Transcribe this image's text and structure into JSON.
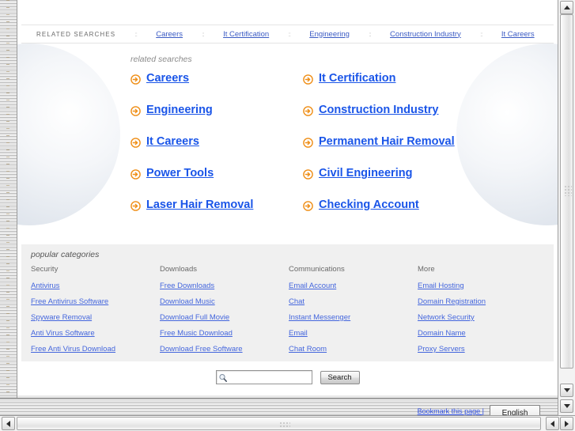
{
  "related_nav": {
    "label": "RELATED SEARCHES",
    "separator": "::",
    "links": [
      "Careers",
      "It Certification",
      "Engineering",
      "Construction Industry",
      "It Careers"
    ]
  },
  "main": {
    "caption": "related searches",
    "links": [
      [
        "Careers",
        "It Certification"
      ],
      [
        "Engineering",
        "Construction Industry"
      ],
      [
        "It Careers",
        "Permanent Hair Removal"
      ],
      [
        "Power Tools",
        "Civil Engineering"
      ],
      [
        "Laser Hair Removal",
        "Checking Account"
      ]
    ]
  },
  "categories": {
    "caption": "popular categories",
    "columns": [
      {
        "heading": "Security",
        "links": [
          "Antivirus",
          "Free Antivirus Software",
          "Spyware Removal",
          "Anti Virus Software",
          "Free Anti Virus Download"
        ]
      },
      {
        "heading": "Downloads",
        "links": [
          "Free Downloads",
          "Download Music",
          "Download Full Movie",
          "Free Music Download",
          "Download Free Software"
        ]
      },
      {
        "heading": "Communications",
        "links": [
          "Email Account",
          "Chat",
          "Instant Messenger",
          "Email",
          "Chat Room"
        ]
      },
      {
        "heading": "More",
        "links": [
          "Email Hosting",
          "Domain Registration",
          "Network Security",
          "Domain Name",
          "Proxy Servers"
        ]
      }
    ]
  },
  "search": {
    "value": "",
    "placeholder": "",
    "button_label": "Search",
    "icon": "magnifier-icon"
  },
  "status": {
    "bookmark_label": "Bookmark this page |",
    "language": "English"
  },
  "colors": {
    "link_blue": "#1a55e8",
    "nav_link_blue": "#3b5bc4",
    "category_link_blue": "#4466dd",
    "arrow_orange": "#ef8e16",
    "panel_gray": "#f0f0f0",
    "blob_blue_gray": "#e2e7ee"
  }
}
